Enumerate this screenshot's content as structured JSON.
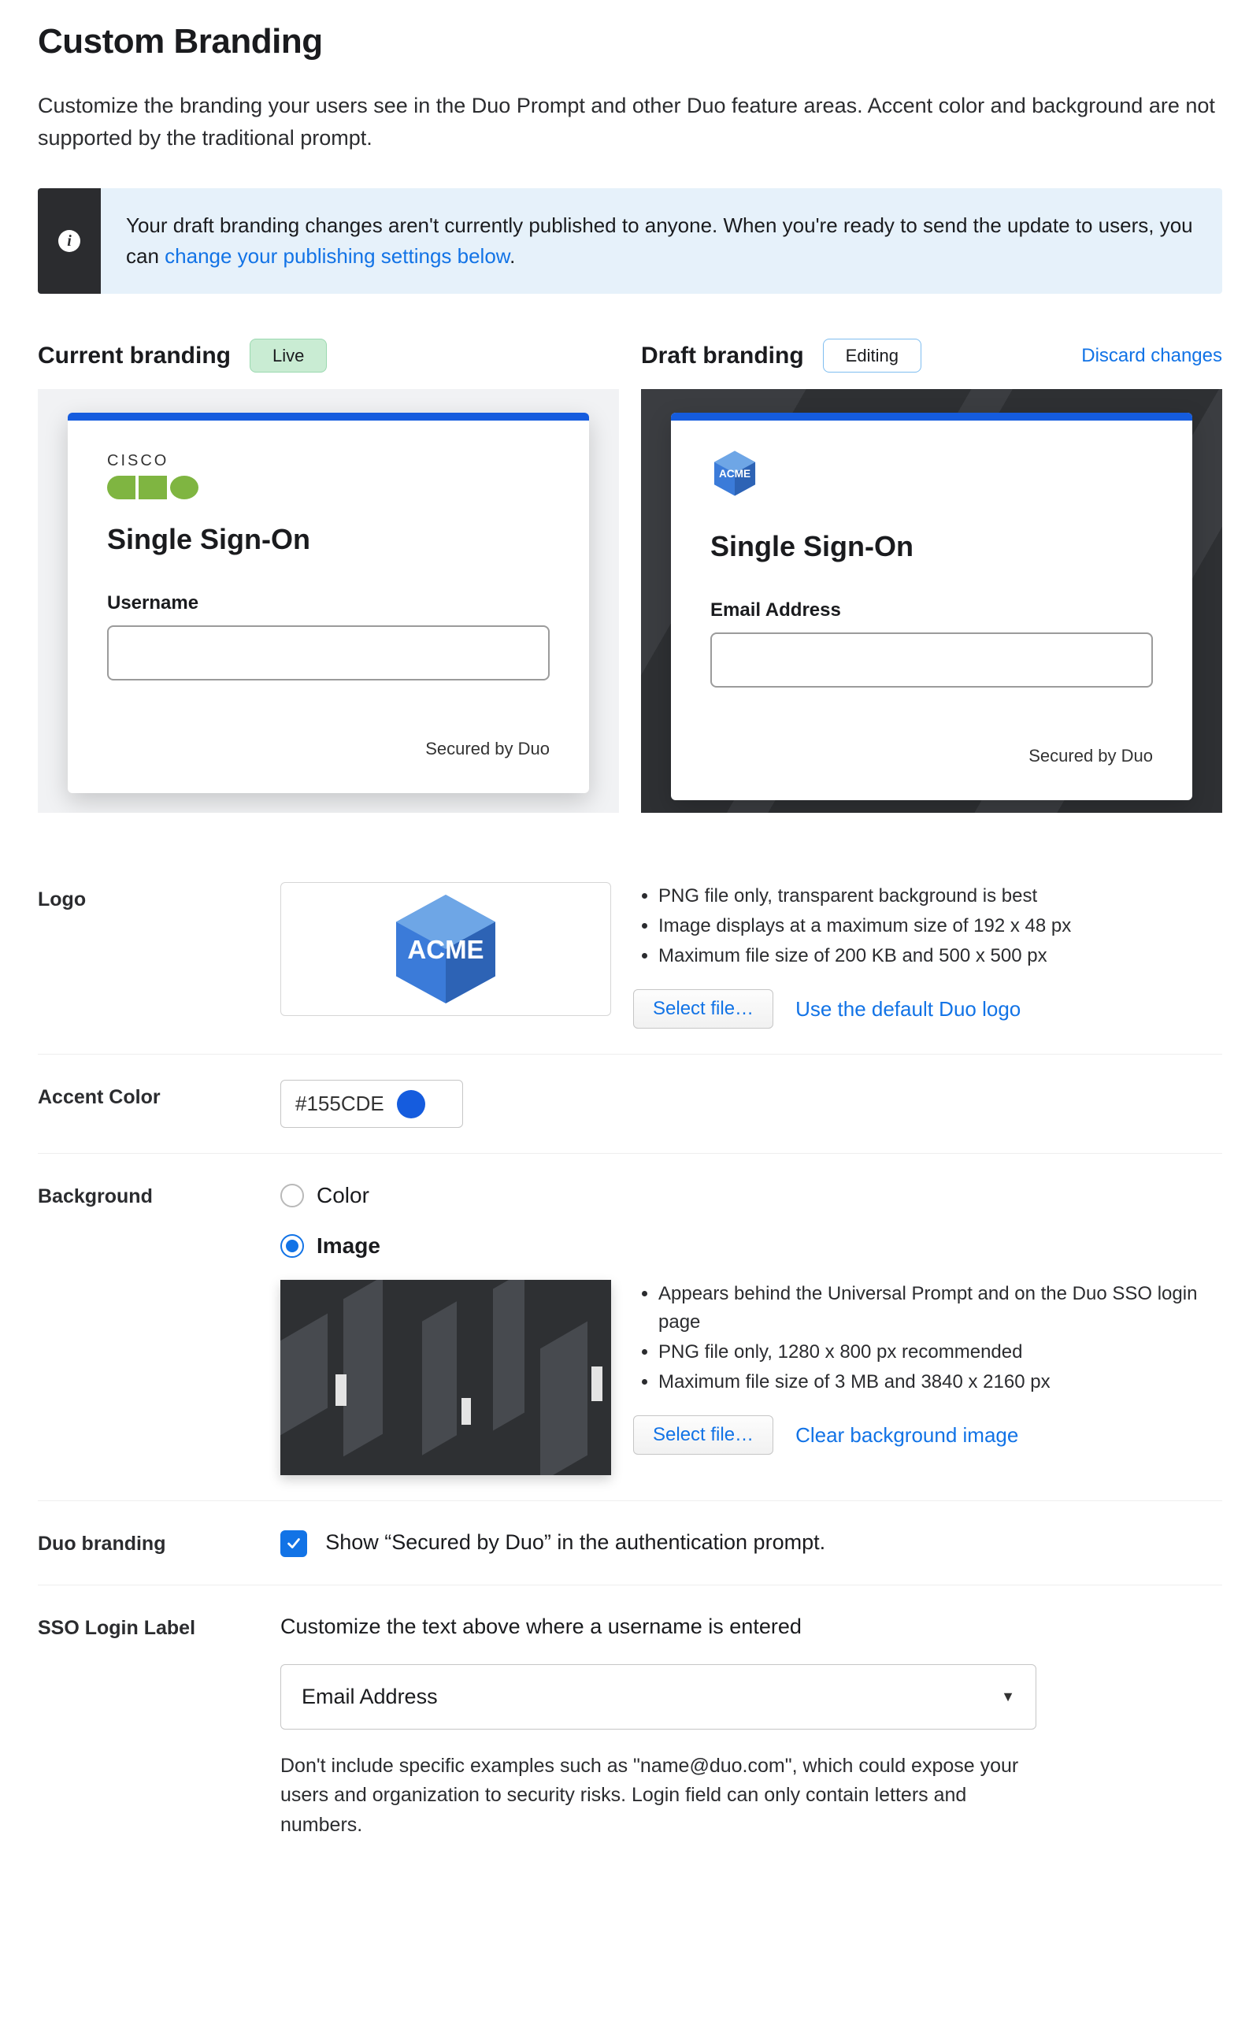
{
  "page": {
    "title": "Custom Branding",
    "intro": "Customize the branding your users see in the Duo Prompt and other Duo feature areas. Accent color and background are not supported by the traditional prompt."
  },
  "info": {
    "text_pre": "Your draft branding changes aren't currently published to anyone. When you're ready to send the update to users, you can ",
    "link": "change your publishing settings below",
    "text_post": "."
  },
  "previews": {
    "current": {
      "heading": "Current branding",
      "pill": "Live",
      "logo_brand": "CISCO",
      "card_title": "Single Sign-On",
      "field_label": "Username",
      "secured": "Secured by Duo"
    },
    "draft": {
      "heading": "Draft branding",
      "pill": "Editing",
      "discard": "Discard changes",
      "logo_text": "ACME",
      "card_title": "Single Sign-On",
      "field_label": "Email Address",
      "secured": "Secured by Duo"
    }
  },
  "logo": {
    "label": "Logo",
    "badge_text": "ACME",
    "notes": [
      "PNG file only, transparent background is best",
      "Image displays at a maximum size of 192 x 48 px",
      "Maximum file size of 200 KB and 500 x 500 px"
    ],
    "select_file": "Select file…",
    "use_default": "Use the default Duo logo"
  },
  "accent": {
    "label": "Accent Color",
    "value": "#155CDE"
  },
  "background": {
    "label": "Background",
    "option_color": "Color",
    "option_image": "Image",
    "selected": "image",
    "notes": [
      "Appears behind the Universal Prompt and on the Duo SSO login page",
      "PNG file only, 1280 x 800 px recommended",
      "Maximum file size of 3 MB and 3840 x 2160 px"
    ],
    "select_file": "Select file…",
    "clear": "Clear background image"
  },
  "duo_branding": {
    "label": "Duo branding",
    "checked": true,
    "text": "Show “Secured by Duo” in the authentication prompt."
  },
  "sso_label": {
    "label": "SSO Login Label",
    "desc": "Customize the text above where a username is entered",
    "value": "Email Address",
    "hint": "Don't include specific examples such as \"name@duo.com\", which could expose your users and organization to security risks. Login field can only contain letters and numbers."
  }
}
